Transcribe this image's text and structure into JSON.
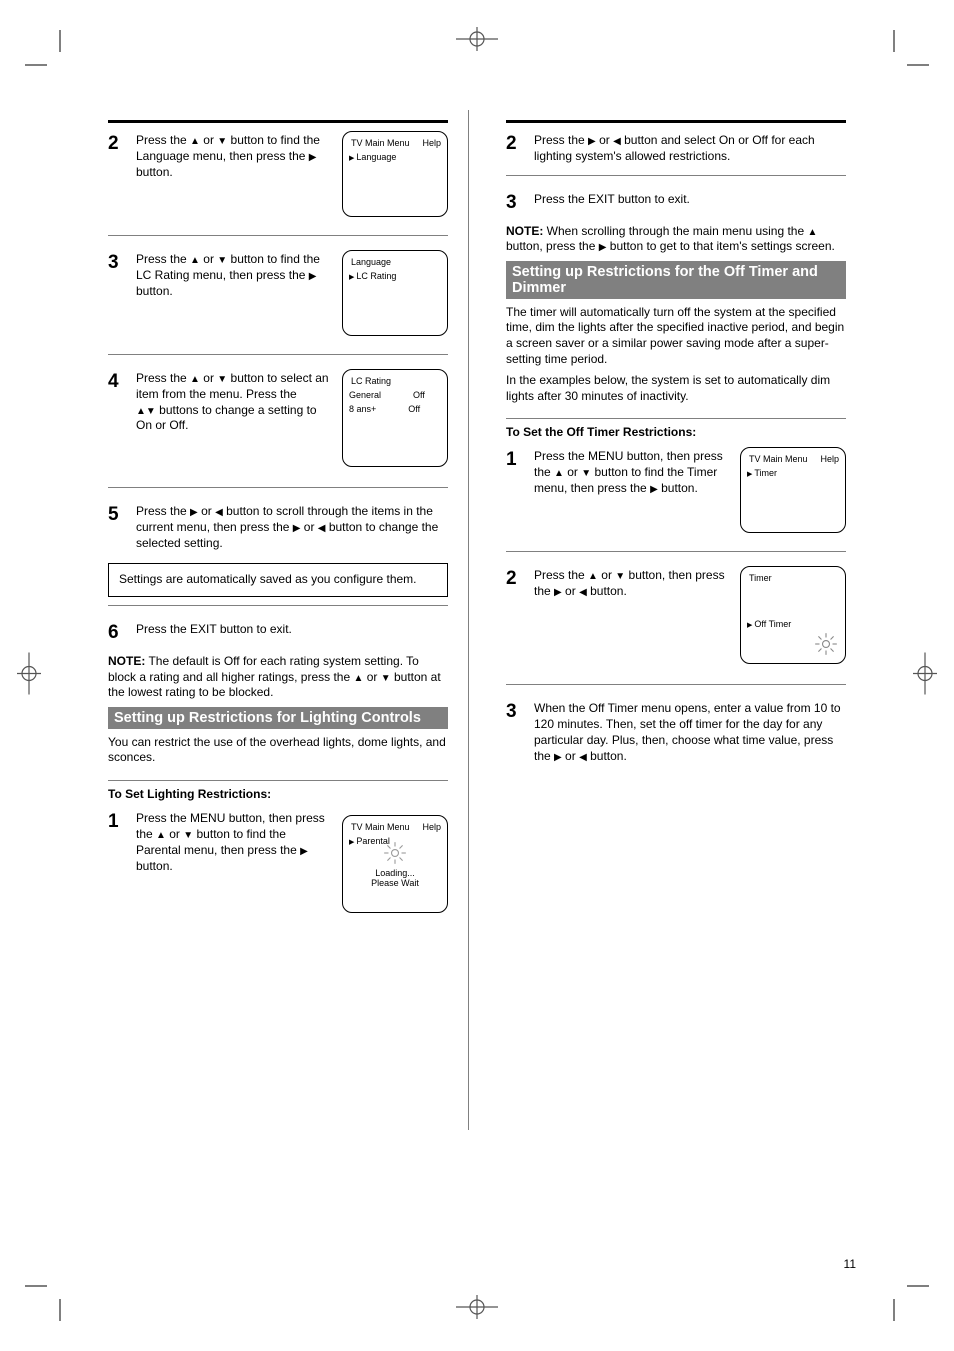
{
  "page_number": "11",
  "left": {
    "step2": {
      "num": "2",
      "text_pre": "Press the ",
      "or": " or ",
      "text_post": " button to find the Language menu, then press the ",
      "tail": " button."
    },
    "mini2": {
      "bar": "TV Main Menu",
      "help": "Help",
      "item": "Language"
    },
    "step3": {
      "num": "3",
      "text_pre": "Press the ",
      "or": " or ",
      "text_post": " button to find the LC Rating menu, then press the ",
      "tail": " button."
    },
    "mini3": {
      "bar": "Language",
      "item": "LC Rating"
    },
    "step4": {
      "num": "4",
      "text_pre": "Press the ",
      "or": " or ",
      "text_post": " button to select an item from the menu. Press the ",
      "tail": " buttons to change a setting to On or Off."
    },
    "mini4": {
      "bar": "LC Rating",
      "item1": "General",
      "item1v": "Off",
      "item2": "8 ans+",
      "item2v": "Off"
    },
    "step5": {
      "num": "5",
      "text_pre": "Press the ",
      "text_mid": " or ",
      "text_post": " button to scroll through the items in the current menu, then press the ",
      "or": " or ",
      "tail": " button to change the selected setting."
    },
    "configbox": "Settings are automatically saved as you configure them.",
    "step6": {
      "num": "6",
      "text": "Press the EXIT button to exit."
    },
    "note": {
      "label": "NOTE:",
      "text": " The default is Off for each rating system setting. To block a rating and all higher ratings, press the ",
      "mid": " or ",
      "text2": " button at the lowest rating to be blocked."
    },
    "graybar": "Setting up Restrictions for Lighting Controls",
    "subtext": "You can restrict the use of the overhead lights, dome lights, and sconces.",
    "section_title": "To Set Lighting Restrictions:",
    "step1b": {
      "num": "1",
      "text_pre": "Press the MENU button, then press the ",
      "or": " or ",
      "text_post": " button to find the Parental menu, then press the ",
      "tail": " button."
    },
    "mini1b": {
      "bar": "TV Main Menu",
      "help": "Help",
      "item": "Parental",
      "loading": "Loading... Please Wait"
    }
  },
  "right": {
    "step2": {
      "num": "2",
      "text_pre": "Press the ",
      "or": " or ",
      "text_post": " button and select On or Off for each lighting system's allowed restrictions."
    },
    "step3": {
      "num": "3",
      "text": "Press the EXIT button to exit."
    },
    "note": {
      "label": "NOTE:",
      "text": " When scrolling through the main menu using the ",
      "mid": " button, press the ",
      "text2": " button to get to that item's settings screen."
    },
    "graybar": "Setting up Restrictions for the Off Timer and Dimmer",
    "subtext1": "The timer will automatically turn off the system at the specified time, dim the lights after the specified inactive period, and begin a screen saver or a similar power saving mode after a super-setting time period.",
    "subtext2": "In the examples below, the system is set to automatically dim lights after 30 minutes of inactivity.",
    "section_title": "To Set the Off Timer Restrictions:",
    "step1": {
      "num": "1",
      "text_pre": "Press the MENU button, then press the ",
      "or": " or ",
      "text_post": " button to find the Timer menu, then press the ",
      "tail": " button."
    },
    "mini1": {
      "bar": "TV Main Menu",
      "help": "Help",
      "item": "Timer"
    },
    "step2b": {
      "num": "2",
      "text_pre": "Press the ",
      "or": " or ",
      "text_post": " button, then press the ",
      "tail_or": " or ",
      "tail": " button."
    },
    "mini2b": {
      "bar": "Timer",
      "item": "Off Timer"
    },
    "step3b": {
      "num": "3",
      "text": "When the Off Timer menu opens, enter a value from 10 to 120 minutes. Then, set the off timer for the day for any particular day. Plus, then, choose what time value, press the ",
      "or": " or ",
      "tail": " button."
    }
  }
}
